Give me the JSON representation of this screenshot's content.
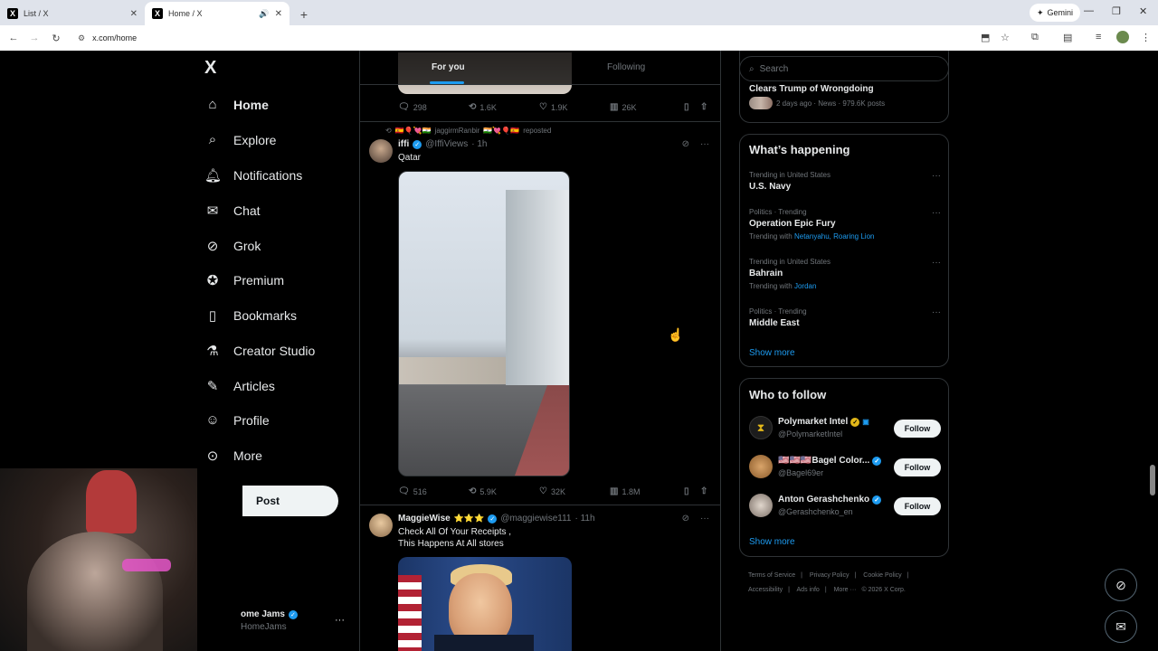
{
  "browser": {
    "tabs": [
      {
        "label": "List / X",
        "close": "✕"
      },
      {
        "label": "Home / X",
        "close": "✕"
      }
    ],
    "new_tab": "+",
    "gemini_label": "Gemini",
    "url": "x.com/home"
  },
  "nav": {
    "logo": "X",
    "items": [
      {
        "label": "Home",
        "icon": "home-icon"
      },
      {
        "label": "Explore",
        "icon": "search-icon"
      },
      {
        "label": "Notifications",
        "icon": "bell-icon"
      },
      {
        "label": "Chat",
        "icon": "mail-icon"
      },
      {
        "label": "Grok",
        "icon": "grok-icon"
      },
      {
        "label": "Premium",
        "icon": "premium-icon"
      },
      {
        "label": "Bookmarks",
        "icon": "bookmark-icon"
      },
      {
        "label": "Creator Studio",
        "icon": "flask-icon"
      },
      {
        "label": "Articles",
        "icon": "article-icon"
      },
      {
        "label": "Profile",
        "icon": "person-icon"
      },
      {
        "label": "More",
        "icon": "more-circle-icon"
      }
    ],
    "post_label": "Post",
    "account_name": "ome Jams",
    "account_handle": "HomeJams"
  },
  "feed": {
    "tabs": [
      "For you",
      "Following"
    ],
    "top_post_actions": {
      "replies": "298",
      "reposts": "1.6K",
      "likes": "1.9K",
      "views": "26K"
    },
    "tweet1": {
      "repost_by": "jaggirmRanbir",
      "repost_suffix": "reposted",
      "name": "iffi",
      "handle": "@IffiViews",
      "time": "· 1h",
      "text": "Qatar",
      "actions": {
        "replies": "516",
        "reposts": "5.9K",
        "likes": "32K",
        "views": "1.8M"
      }
    },
    "tweet2": {
      "name": "MaggieWise",
      "stars": "⭐⭐⭐",
      "handle": "@maggiewise111",
      "time": "· 11h",
      "text_line1": "Check All Of Your Receipts ,",
      "text_line2": "This Happens At All stores"
    }
  },
  "right": {
    "search_placeholder": "Search",
    "news_headline": "Clears Trump of Wrongdoing",
    "news_meta": "2 days ago · News · 979.6K posts",
    "happening_title": "What’s happening",
    "trends": [
      {
        "category": "Trending in United States",
        "name": "U.S. Navy",
        "with_label": "",
        "with": ""
      },
      {
        "category": "Politics · Trending",
        "name": "Operation Epic Fury",
        "with_label": "Trending with",
        "with": "Netanyahu, Roaring Lion"
      },
      {
        "category": "Trending in United States",
        "name": "Bahrain",
        "with_label": "Trending with",
        "with": "Jordan"
      },
      {
        "category": "Politics · Trending",
        "name": "Middle East",
        "with_label": "",
        "with": ""
      }
    ],
    "show_more": "Show more",
    "who_title": "Who to follow",
    "follows": [
      {
        "name": "Polymarket Intel",
        "handle": "@PolymarketIntel"
      },
      {
        "name": "🇺🇸🇺🇸🇺🇸Bagel Color...",
        "handle": "@Bagel69er"
      },
      {
        "name": "Anton Gerashchenko",
        "handle": "@Gerashchenko_en"
      }
    ],
    "follow_label": "Follow",
    "footer": [
      "Terms of Service",
      "|",
      "Privacy Policy",
      "|",
      "Cookie Policy",
      "|",
      "Accessibility",
      "|",
      "Ads info",
      "|",
      "More ···",
      "© 2026 X Corp."
    ]
  },
  "colors": {
    "accent": "#1d9bf0",
    "bg": "#000000",
    "text": "#e7e9ea",
    "muted": "#71767b",
    "border": "#2f3336"
  }
}
